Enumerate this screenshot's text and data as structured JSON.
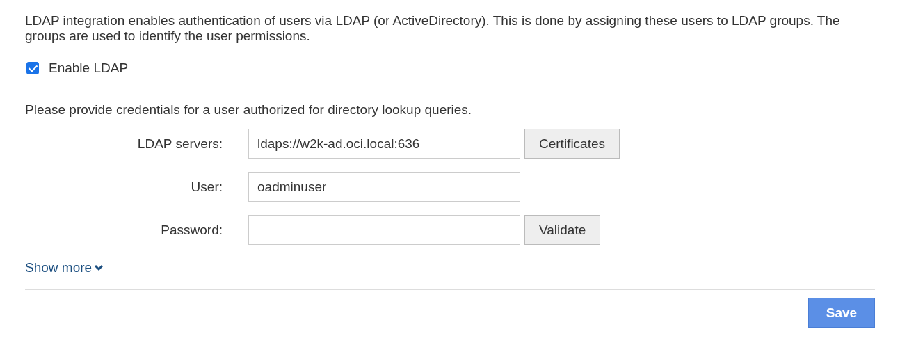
{
  "intro": "LDAP integration enables authentication of users via LDAP (or ActiveDirectory). This is done by assigning these users to LDAP groups. The groups are used to identify the user permissions.",
  "enable": {
    "label": "Enable LDAP",
    "checked": true
  },
  "prompt": "Please provide credentials for a user authorized for directory lookup queries.",
  "fields": [
    {
      "label": "LDAP servers:",
      "value": "ldaps://w2k-ad.oci.local:636",
      "button": "Certificates"
    },
    {
      "label": "User:",
      "value": "oadminuser"
    },
    {
      "label": "Password:",
      "button": "Validate"
    }
  ],
  "show_more": "Show more",
  "save": "Save"
}
